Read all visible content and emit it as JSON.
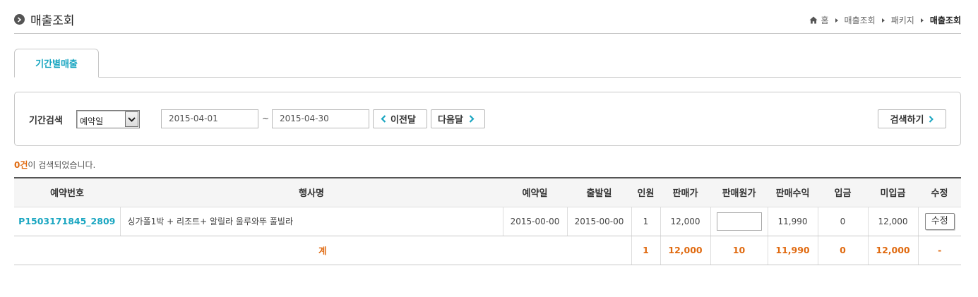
{
  "header": {
    "title": "매출조회",
    "breadcrumb": [
      "홈",
      "매출조회",
      "패키지",
      "매출조회"
    ]
  },
  "tabs": [
    {
      "label": "기간별매출",
      "active": true
    }
  ],
  "search": {
    "label": "기간검색",
    "date_type": "예약일",
    "date_from": "2015-04-01",
    "tilde": "~",
    "date_to": "2015-04-30",
    "prev_label": "이전달",
    "next_label": "다음달",
    "search_label": "검색하기"
  },
  "result": {
    "count": "0건",
    "suffix": "이 검색되었습니다."
  },
  "table": {
    "headers": [
      "예약번호",
      "행사명",
      "예약일",
      "출발일",
      "인원",
      "판매가",
      "판매원가",
      "판매수익",
      "입금",
      "미입금",
      "수정"
    ],
    "rows": [
      {
        "reservation_no": "P1503171845_2809",
        "event_name": "싱가폴1박 + 리조트+ 알릴라 울루와뚜 풀빌라",
        "reserve_date": "2015-00-00",
        "depart_date": "2015-00-00",
        "people": "1",
        "sale_price": "12,000",
        "cost_price": "",
        "profit": "11,990",
        "paid": "0",
        "unpaid": "12,000",
        "edit_label": "수정"
      }
    ],
    "total": {
      "label": "계",
      "people": "1",
      "sale_price": "12,000",
      "cost_price": "10",
      "profit": "11,990",
      "paid": "0",
      "unpaid": "12,000",
      "edit": "-"
    }
  },
  "colors": {
    "accent": "#1aa6c1",
    "highlight": "#e06a10"
  }
}
